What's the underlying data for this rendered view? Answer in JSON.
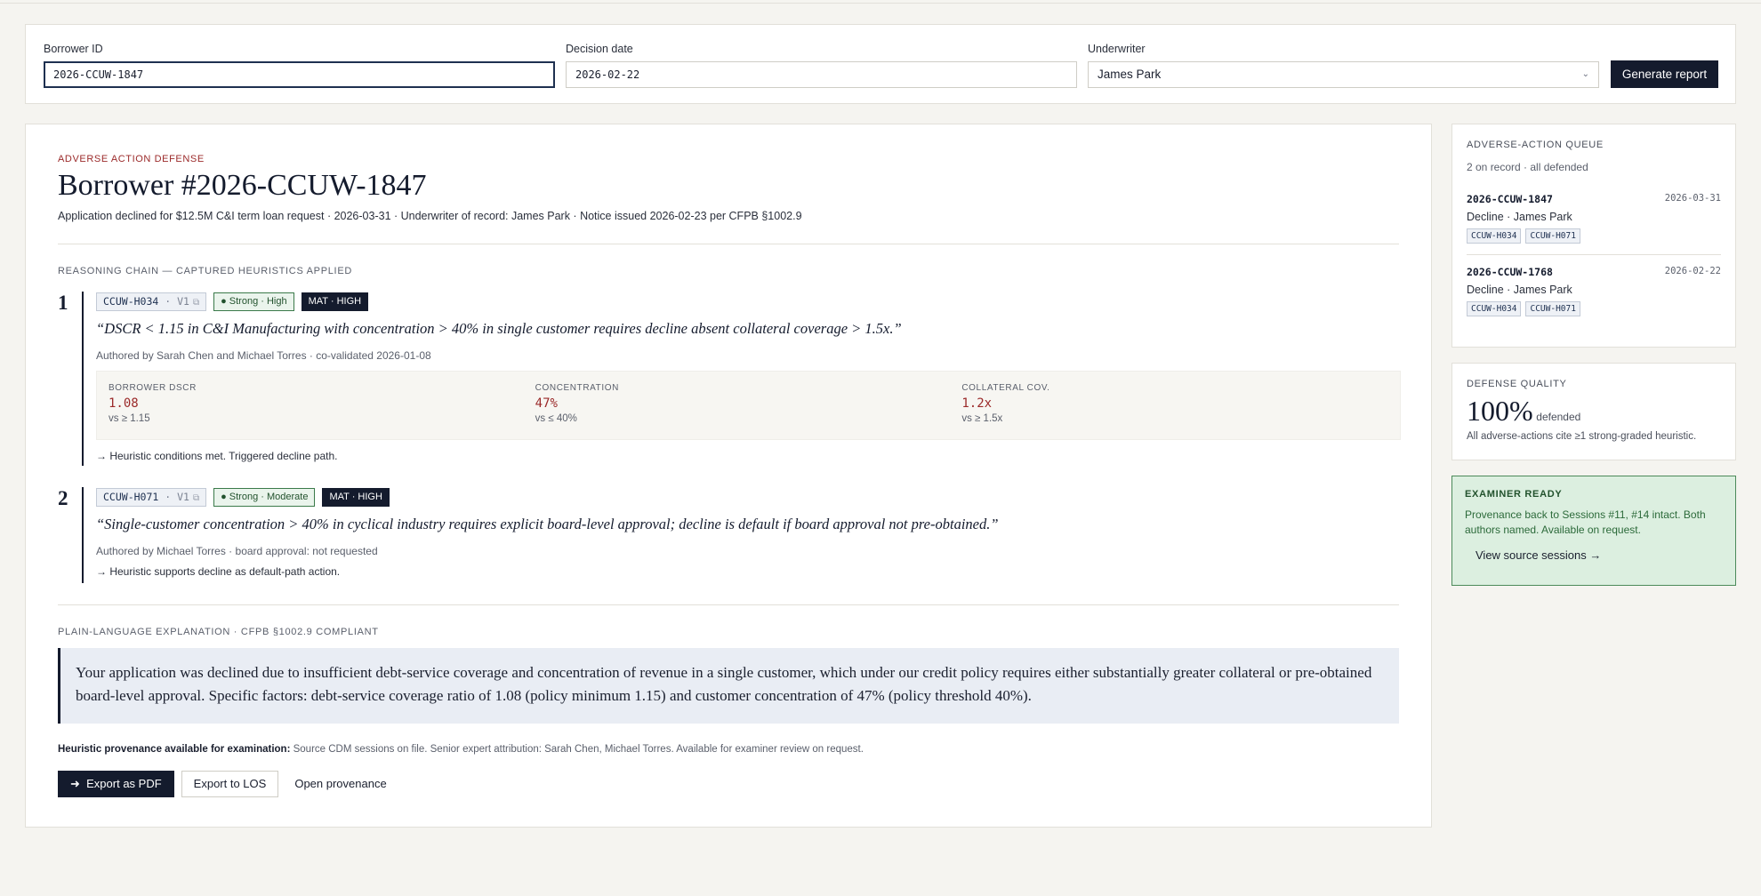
{
  "filters": {
    "borrower_id": {
      "label": "Borrower ID",
      "value": "2026-CCUW-1847"
    },
    "decision_date": {
      "label": "Decision date",
      "value": "2026-02-22"
    },
    "underwriter": {
      "label": "Underwriter",
      "value": "James Park"
    },
    "generate_label": "Generate report"
  },
  "report": {
    "eyebrow": "ADVERSE ACTION DEFENSE",
    "title": "Borrower #2026-CCUW-1847",
    "subtitle": "Application declined for $12.5M C&I term loan request · 2026-03-31 · Underwriter of record: James Park · Notice issued 2026-02-23 per CFPB §1002.9",
    "reasoning_label": "REASONING CHAIN — CAPTURED HEURISTICS APPLIED",
    "steps": [
      {
        "num": "1",
        "id": "CCUW-H034",
        "version": "· V1",
        "strength": "● Strong · High",
        "materiality": "MAT · HIGH",
        "quote": "“DSCR < 1.15 in C&I Manufacturing with concentration > 40% in single customer requires decline absent collateral coverage > 1.5x.”",
        "authored": "Authored by Sarah Chen and Michael Torres · co-validated 2026-01-08",
        "metrics": [
          {
            "label": "BORROWER DSCR",
            "value": "1.08",
            "compare": "vs ≥ 1.15"
          },
          {
            "label": "CONCENTRATION",
            "value": "47%",
            "compare": "vs ≤ 40%"
          },
          {
            "label": "COLLATERAL COV.",
            "value": "1.2x",
            "compare": "vs ≥ 1.5x"
          }
        ],
        "outcome": "→ Heuristic conditions met. Triggered decline path."
      },
      {
        "num": "2",
        "id": "CCUW-H071",
        "version": "· V1",
        "strength": "● Strong · Moderate",
        "materiality": "MAT · HIGH",
        "quote": "“Single-customer concentration > 40% in cyclical industry requires explicit board-level approval; decline is default if board approval not pre-obtained.”",
        "authored": "Authored by Michael Torres · board approval: not requested",
        "outcome": "→ Heuristic supports decline as default-path action."
      }
    ],
    "explanation_label": "PLAIN-LANGUAGE EXPLANATION · CFPB §1002.9 COMPLIANT",
    "explanation": "Your application was declined due to insufficient debt-service coverage and concentration of revenue in a single customer, which under our credit policy requires either substantially greater collateral or pre-obtained board-level approval. Specific factors: debt-service coverage ratio of 1.08 (policy minimum 1.15) and customer concentration of 47% (policy threshold 40%).",
    "provenance_bold": "Heuristic provenance available for examination:",
    "provenance_text": " Source CDM sessions on file. Senior expert attribution: Sarah Chen, Michael Torres. Available for examiner review on request.",
    "actions": {
      "export_pdf": "Export as PDF",
      "export_los": "Export to LOS",
      "open_prov": "Open provenance"
    }
  },
  "queue": {
    "label": "ADVERSE-ACTION QUEUE",
    "summary": "2 on record · all defended",
    "items": [
      {
        "id": "2026-CCUW-1847",
        "date": "2026-03-31",
        "desc": "Decline · James Park",
        "tags": [
          "CCUW-H034",
          "CCUW-H071"
        ]
      },
      {
        "id": "2026-CCUW-1768",
        "date": "2026-02-22",
        "desc": "Decline · James Park",
        "tags": [
          "CCUW-H034",
          "CCUW-H071"
        ]
      }
    ]
  },
  "quality": {
    "label": "DEFENSE QUALITY",
    "value": "100%",
    "unit": "defended",
    "note": "All adverse-actions cite ≥1 strong-graded heuristic."
  },
  "examiner": {
    "label": "EXAMINER READY",
    "text": "Provenance back to Sessions #11, #14 intact. Both authors named. Available on request.",
    "link": "View source sessions →"
  }
}
